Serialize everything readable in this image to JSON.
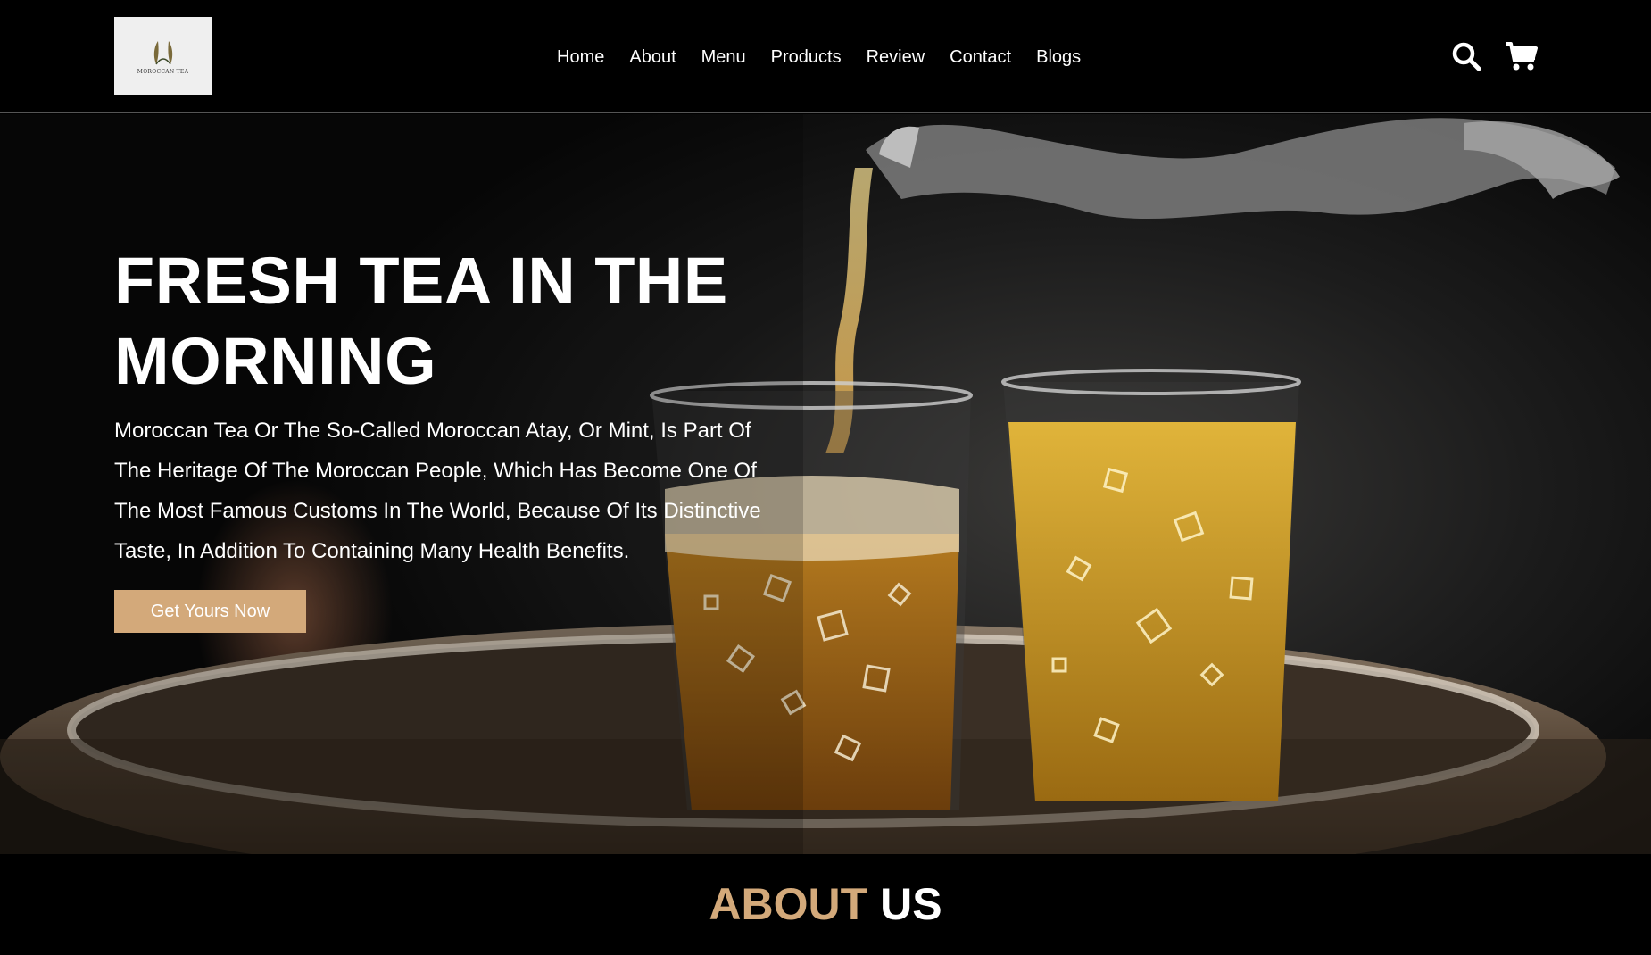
{
  "brand": {
    "logo_text": "MOROCCAN TEA"
  },
  "nav": {
    "items": [
      {
        "label": "Home"
      },
      {
        "label": "About"
      },
      {
        "label": "Menu"
      },
      {
        "label": "Products"
      },
      {
        "label": "Review"
      },
      {
        "label": "Contact"
      },
      {
        "label": "Blogs"
      }
    ]
  },
  "header_icons": [
    "search-icon",
    "cart-icon"
  ],
  "hero": {
    "title": "FRESH TEA IN THE MORNING",
    "description": "Moroccan Tea Or The So-Called Moroccan Atay, Or Mint, Is Part Of The Heritage Of The Moroccan People, Which Has Become One Of The Most Famous Customs In The World, Because Of Its Distinctive Taste, In Addition To Containing Many Health Benefits.",
    "cta_label": "Get Yours Now"
  },
  "about": {
    "title_accent": "ABOUT",
    "title_rest": "US"
  },
  "colors": {
    "accent": "#d3a97a",
    "background": "#000000",
    "text": "#ffffff"
  }
}
